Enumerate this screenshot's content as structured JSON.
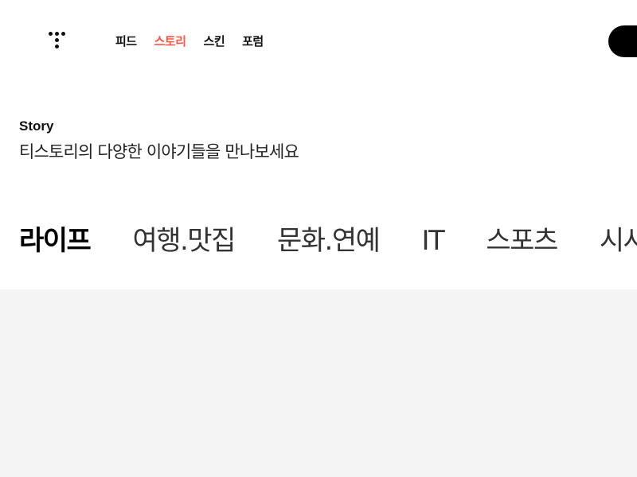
{
  "header": {
    "logo_icon": "tistory-dots-icon",
    "nav": [
      {
        "label": "피드",
        "active": false
      },
      {
        "label": "스토리",
        "active": true
      },
      {
        "label": "스킨",
        "active": false
      },
      {
        "label": "포럼",
        "active": false
      }
    ],
    "accent_color": "#ff5544"
  },
  "intro": {
    "title": "Story",
    "subtitle": "티스토리의 다양한 이야기들을 만나보세요"
  },
  "categories": [
    {
      "label": "라이프",
      "active": true
    },
    {
      "label": "여행.맛집",
      "active": false
    },
    {
      "label": "문화.연예",
      "active": false
    },
    {
      "label": "IT",
      "active": false
    },
    {
      "label": "스포츠",
      "active": false
    },
    {
      "label": "시사",
      "active": false
    }
  ]
}
